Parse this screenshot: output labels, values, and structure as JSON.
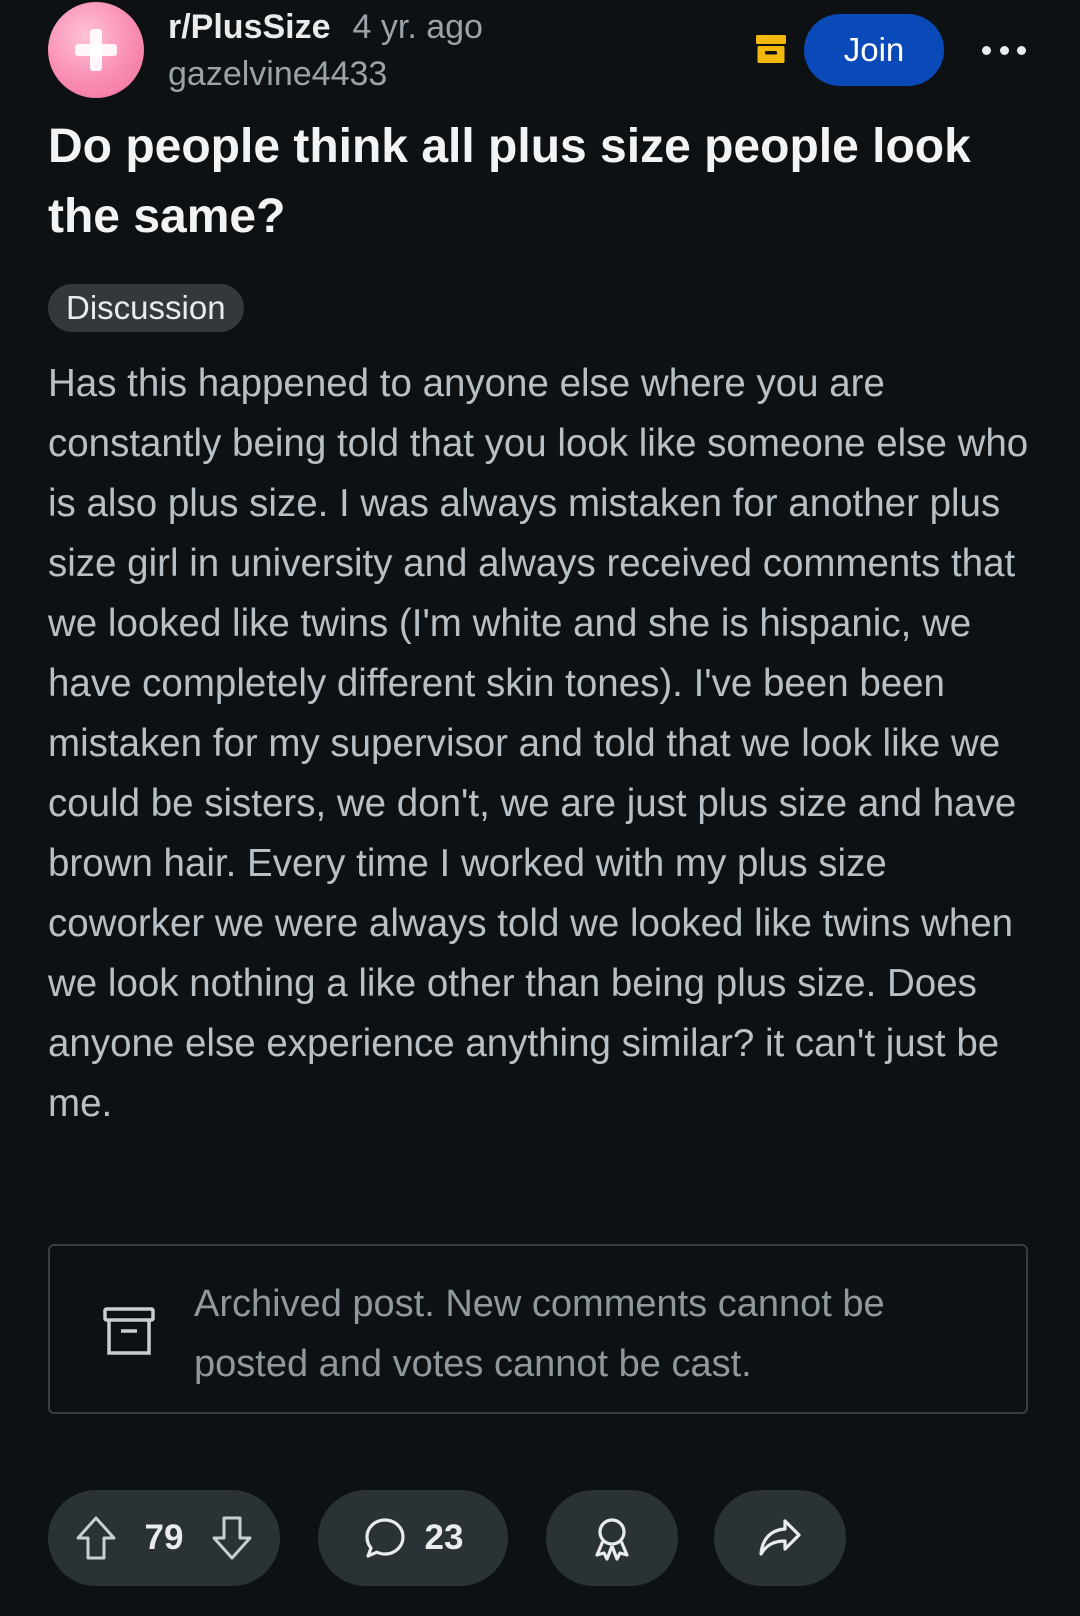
{
  "post": {
    "subreddit": "r/PlusSize",
    "time_ago": "4 yr. ago",
    "author": "gazelvine4433",
    "title": "Do people think all plus size people look the same?",
    "flair": "Discussion",
    "body": "Has this happened to anyone else where you are constantly being told that you look like someone else who is also plus size. I was always mistaken for another plus size girl in university and always received comments that we looked like twins (I'm white and she is hispanic, we have completely different skin tones). I've been been mistaken for my supervisor and told that we look like we could be sisters, we don't, we are just plus size and have brown hair. Every time I worked with my plus size coworker we were always told we looked like twins when we look nothing a like other than being plus size. Does anyone else experience anything similar? it can't just be me."
  },
  "header": {
    "join_label": "Join",
    "icons": [
      "subreddit-avatar-plus-icon",
      "archive-icon",
      "more-options-icon"
    ]
  },
  "archived_notice": {
    "text": "Archived post. New comments cannot be posted and votes cannot be cast.",
    "icon": "archive-icon"
  },
  "actions": {
    "vote_count": "79",
    "comment_count": "23",
    "icons": [
      "upvote-icon",
      "downvote-icon",
      "comment-icon",
      "award-icon",
      "share-icon"
    ]
  },
  "colors": {
    "background": "#0e1113",
    "join_button": "#0a49b8",
    "archive_badge": "#f2b90c",
    "pill_background": "#2a3236",
    "avatar_pink": "#f98db4"
  }
}
